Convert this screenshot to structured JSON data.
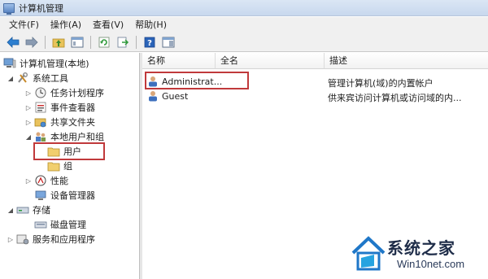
{
  "window": {
    "title": "计算机管理"
  },
  "menu": {
    "items": [
      "文件(F)",
      "操作(A)",
      "查看(V)",
      "帮助(H)"
    ]
  },
  "tree": {
    "root": "计算机管理(本地)",
    "system_tools": "系统工具",
    "task_scheduler": "任务计划程序",
    "event_viewer": "事件查看器",
    "shared_folders": "共享文件夹",
    "local_users_groups": "本地用户和组",
    "users": "用户",
    "groups": "组",
    "performance": "性能",
    "device_manager": "设备管理器",
    "storage": "存储",
    "disk_management": "磁盘管理",
    "services_apps": "服务和应用程序"
  },
  "list": {
    "columns": [
      "名称",
      "全名",
      "描述"
    ],
    "rows": [
      {
        "name": "Administrat...",
        "fullname": "",
        "desc": "管理计算机(域)的内置帐户"
      },
      {
        "name": "Guest",
        "fullname": "",
        "desc": "供来宾访问计算机或访问域的内..."
      }
    ]
  },
  "watermark": {
    "title": "系统之家",
    "subtitle": "Win10net.com"
  },
  "colors": {
    "highlight": "#c0393b",
    "titlebar": "#c8d8ee",
    "chrome": "#f0f0f0"
  }
}
